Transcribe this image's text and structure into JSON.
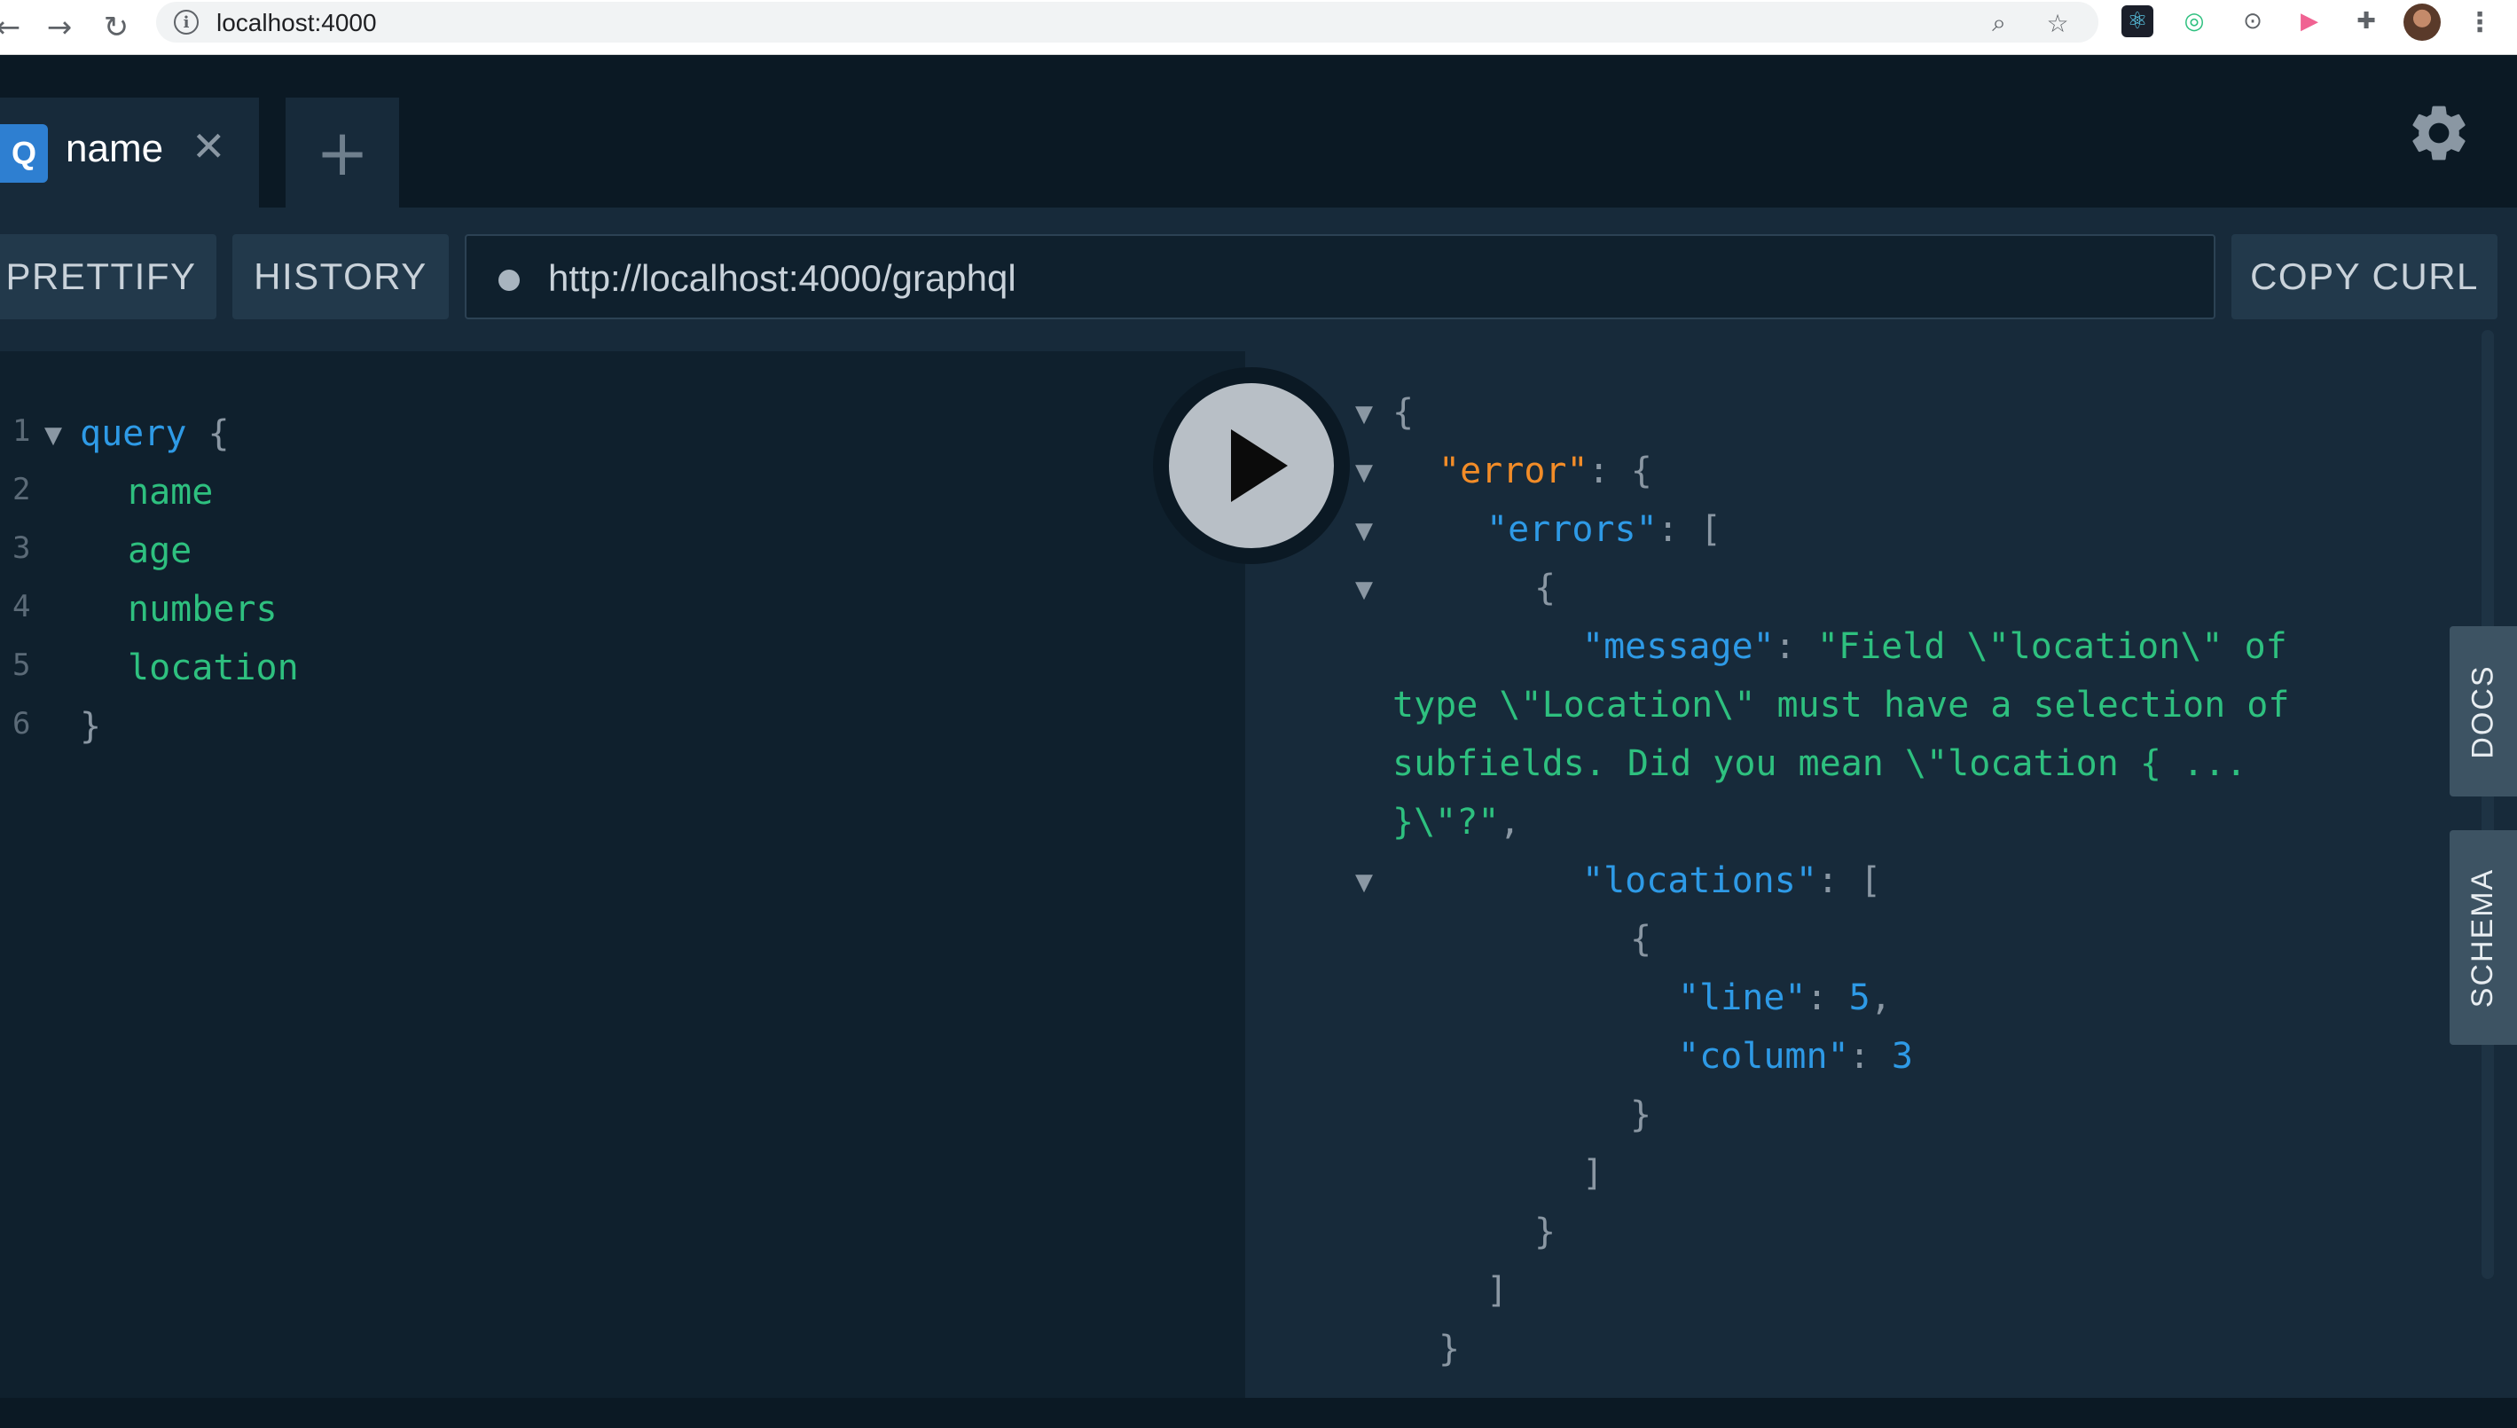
{
  "browser": {
    "url": "localhost:4000",
    "back_icon": "arrow-left-icon",
    "forward_icon": "arrow-right-icon",
    "reload_icon": "reload-icon",
    "info_icon": "info-icon"
  },
  "tabs": [
    {
      "badge": "Q",
      "label": "name",
      "close_icon": "close-icon"
    }
  ],
  "add_tab_icon": "plus-icon",
  "settings_icon": "gear-icon",
  "toolbar": {
    "prettify": "PRETTIFY",
    "history": "HISTORY",
    "endpoint": "http://localhost:4000/graphql",
    "copy_curl": "COPY CURL"
  },
  "editor": {
    "line_numbers": [
      "1",
      "2",
      "3",
      "4",
      "5",
      "6"
    ],
    "query_keyword": "query",
    "open_brace": "{",
    "fields": [
      "name",
      "age",
      "numbers",
      "location"
    ],
    "close_brace": "}"
  },
  "result": {
    "open_brace": "{",
    "error_key": "\"error\"",
    "errors_key": "\"errors\"",
    "message_key": "\"message\"",
    "message_lines": [
      "\"Field \\\"location\\\" of",
      "type \\\"Location\\\" must have a selection of",
      "subfields. Did you mean \\\"location { ...",
      "}\\\"?\""
    ],
    "locations_key": "\"locations\"",
    "line_key": "\"line\"",
    "line_value": "5",
    "column_key": "\"column\"",
    "column_value": "3"
  },
  "side_tabs": {
    "docs": "DOCS",
    "schema": "SCHEMA"
  },
  "colors": {
    "background": "#0f202d",
    "panel": "#172a3a",
    "keyword": "#2e9ae6",
    "field": "#2ec07f",
    "error_key": "#f28c28",
    "badge": "#2e7fd1"
  }
}
